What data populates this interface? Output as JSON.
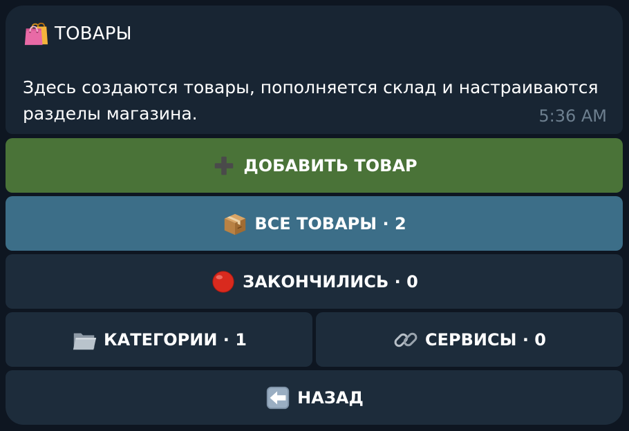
{
  "message": {
    "title": "ТОВАРЫ",
    "title_icon": "shopping-bags-icon",
    "body": "Здесь создаются товары, пополняется склад и настраиваются разделы магазина.",
    "time": "5:36 AM"
  },
  "buttons": {
    "add_product": {
      "label": "ДОБАВИТЬ ТОВАР",
      "icon": "plus-icon",
      "color": "#4a7338"
    },
    "all_products": {
      "label": "ВСЕ ТОВАРЫ · 2",
      "icon": "package-icon",
      "color": "#3c6e88"
    },
    "out_of_stock": {
      "label": "ЗАКОНЧИЛИСЬ · 0",
      "icon": "red-circle-icon",
      "color": "#1d2c3b"
    },
    "categories": {
      "label": "КАТЕГОРИИ · 1",
      "icon": "folder-icon",
      "color": "#1d2c3b"
    },
    "services": {
      "label": "СЕРВИСЫ · 0",
      "icon": "link-icon",
      "color": "#1d2c3b"
    },
    "back": {
      "label": "НАЗАД",
      "icon": "back-arrow-icon",
      "color": "#1d2c3b"
    }
  },
  "colors": {
    "background": "#0e1621",
    "bubble": "#182533",
    "text": "#ffffff",
    "timestamp": "#6d7f8f"
  }
}
